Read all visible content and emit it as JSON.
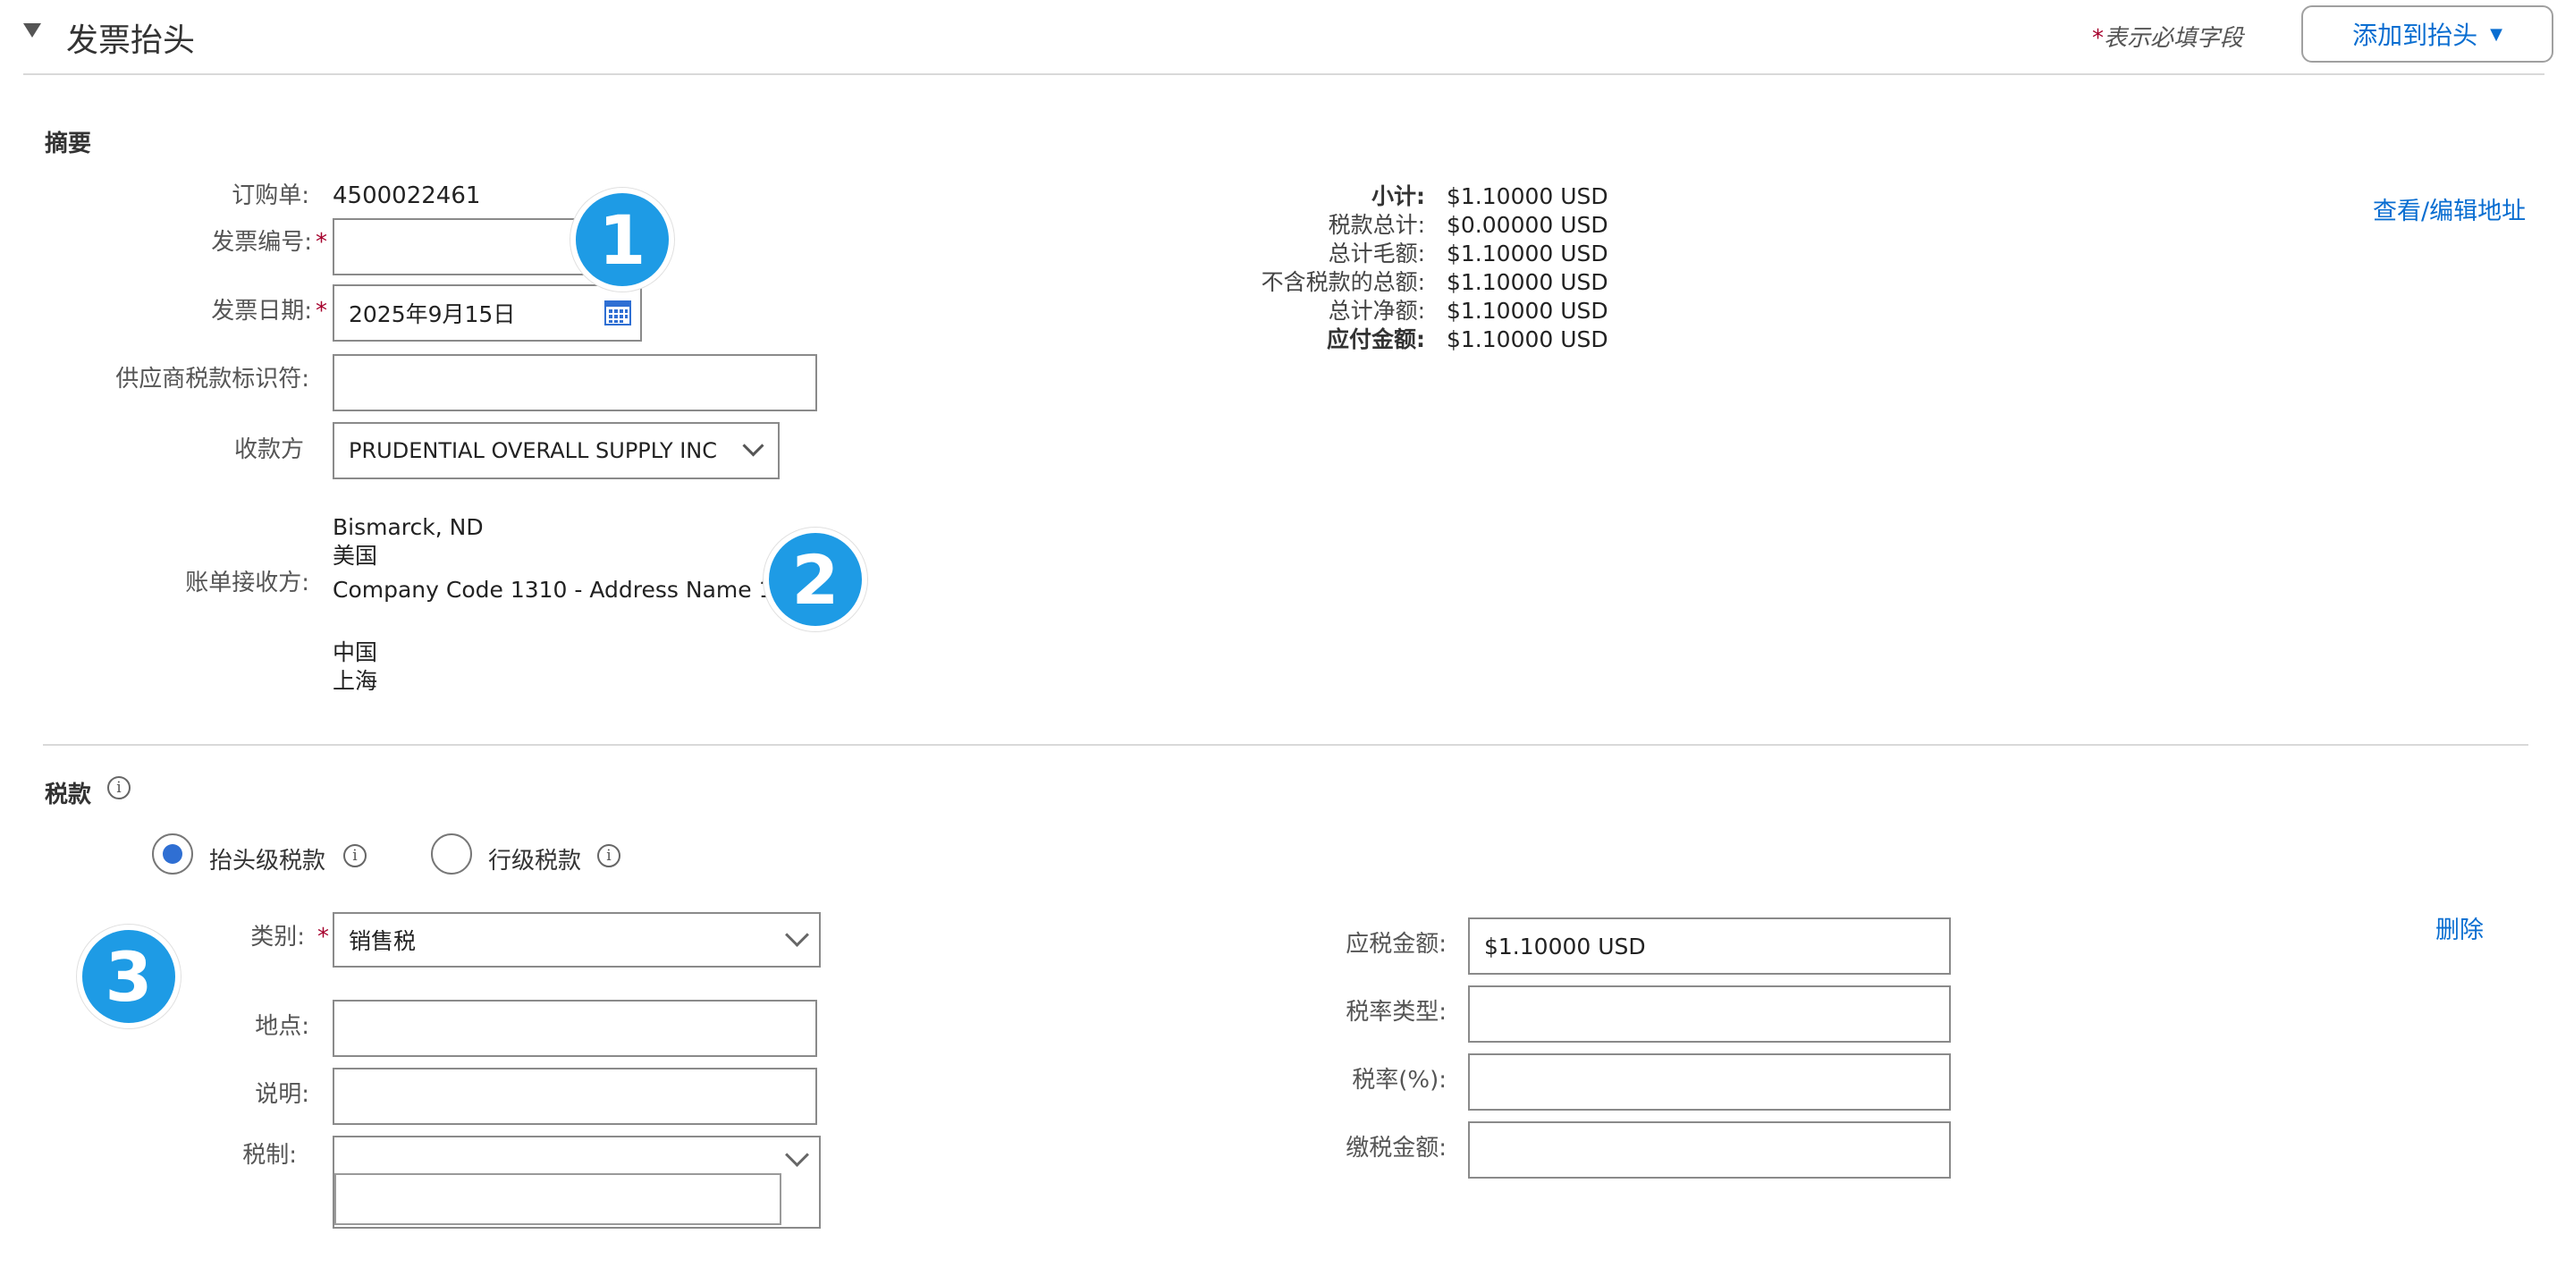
{
  "header": {
    "collapse_icon": "triangle-down-icon",
    "title": "发票抬头",
    "required_star": "*",
    "required_note": "表示必填字段",
    "add_button_label": "添加到抬头",
    "add_button_arrow": "▼"
  },
  "summary": {
    "title": "摘要",
    "po_label": "订购单:",
    "po_value": "4500022461",
    "invoice_no_label": "发票编号:",
    "invoice_no_value": "",
    "invoice_date_label": "发票日期:",
    "invoice_date_value": "2025年9月15日",
    "supplier_tax_label": "供应商税款标识符:",
    "supplier_tax_value": "",
    "payee_label": "收款方",
    "payee_value": "PRUDENTIAL OVERALL SUPPLY INC",
    "bill_to_label": "账单接收方:",
    "bill_to_lines": [
      "Bismarck, ND",
      "美国",
      "Company Code 1310 - Address Name 1",
      "",
      "中国",
      "上海"
    ],
    "view_edit_address": "查看/编辑地址",
    "totals": [
      {
        "label": "小计:",
        "value": "$1.10000 USD",
        "bold": true
      },
      {
        "label": "税款总计:",
        "value": "$0.00000 USD",
        "bold": false
      },
      {
        "label": "总计毛额:",
        "value": "$1.10000 USD",
        "bold": false
      },
      {
        "label": "不含税款的总额:",
        "value": "$1.10000 USD",
        "bold": false
      },
      {
        "label": "总计净额:",
        "value": "$1.10000 USD",
        "bold": false
      },
      {
        "label": "应付金额:",
        "value": "$1.10000 USD",
        "bold": true
      }
    ]
  },
  "tax": {
    "title": "税款",
    "info_glyph": "i",
    "radio_header_label": "抬头级税款",
    "radio_line_label": "行级税款",
    "category_label": "类别:",
    "category_value": "销售税",
    "location_label": "地点:",
    "location_value": "",
    "description_label": "说明:",
    "description_value": "",
    "regime_label": "税制:",
    "regime_value": "",
    "taxable_amount_label": "应税金额:",
    "taxable_amount_value": "$1.10000 USD",
    "rate_type_label": "税率类型:",
    "rate_type_value": "",
    "rate_label": "税率(%):",
    "rate_value": "",
    "tax_amount_label": "缴税金额:",
    "tax_amount_value": "",
    "delete_label": "删除"
  },
  "callouts": {
    "one": "1",
    "two": "2",
    "three": "3",
    "color": "#1e9be5"
  }
}
